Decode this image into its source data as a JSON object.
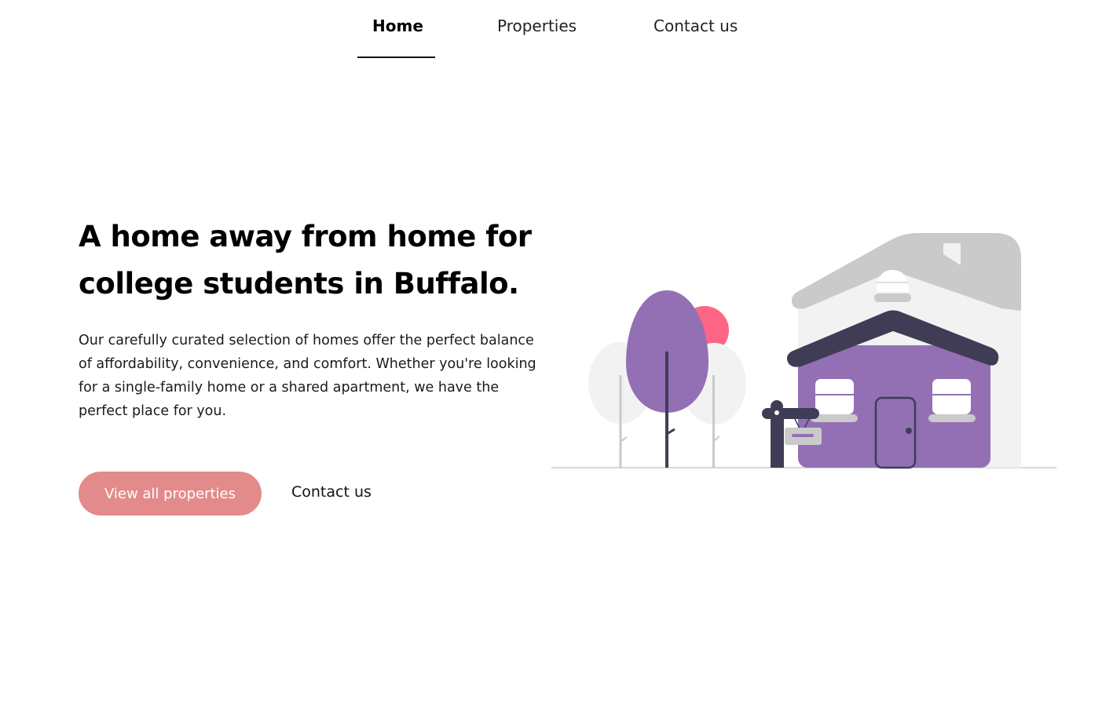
{
  "nav": {
    "items": [
      {
        "label": "Home",
        "active": true
      },
      {
        "label": "Properties",
        "active": false
      },
      {
        "label": "Contact us",
        "active": false
      }
    ]
  },
  "hero": {
    "title": "A home away from home for college students in Buffalo.",
    "description": "Our carefully curated selection of homes offer the perfect balance of affordability, convenience, and comfort. Whether you're looking for a single-family home or a shared apartment, we have the perfect place for you.",
    "primary_button": "View all properties",
    "secondary_link": "Contact us"
  },
  "colors": {
    "accent": "#e38a8a",
    "house": "#9370b4",
    "roof": "#3f3d56",
    "sun": "#ff6584",
    "light_gray": "#f2f2f2",
    "mid_gray": "#cacaca"
  },
  "illustration": {
    "icon": "house-illustration"
  }
}
